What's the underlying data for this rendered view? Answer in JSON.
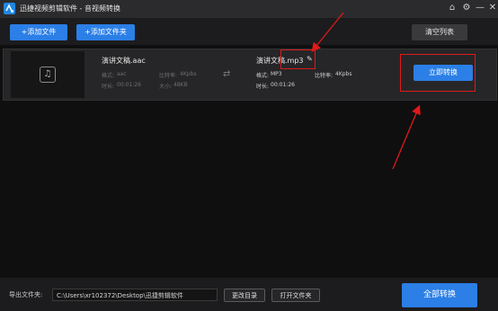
{
  "window": {
    "title": "迅捷视频剪辑软件 - 音视频转换",
    "home_icon": "home-icon",
    "settings_icon": "settings-icon",
    "minimize_icon": "minimize-icon",
    "close_icon": "close-icon"
  },
  "toolbar": {
    "add_file": "+添加文件",
    "add_folder": "+添加文件夹",
    "clear_list": "清空列表"
  },
  "item": {
    "source_name": "演讲文稿.aac",
    "source_format_label": "格式:",
    "source_format": "aac",
    "source_bitrate_label": "比特率:",
    "source_bitrate": "4Kpbs",
    "source_duration_label": "时长:",
    "source_duration": "00:01:26",
    "source_size_label": "大小:",
    "source_size": "48KB",
    "target_name": "演讲文稿.mp3",
    "target_format_label": "格式:",
    "target_format": "MP3",
    "target_bitrate_label": "比特率:",
    "target_bitrate": "4Kpbs",
    "target_duration_label": "时长:",
    "target_duration": "00:01:26",
    "convert_now": "立即转换"
  },
  "footer": {
    "export_label": "导出文件夹:",
    "export_path": "C:\\Users\\xr102372\\Desktop\\迅捷剪辑软件",
    "change_dir": "更改目录",
    "open_folder": "打开文件夹",
    "convert_all": "全部转换"
  },
  "colors": {
    "accent": "#2b7fe6",
    "annotation_red": "#e0191a"
  }
}
